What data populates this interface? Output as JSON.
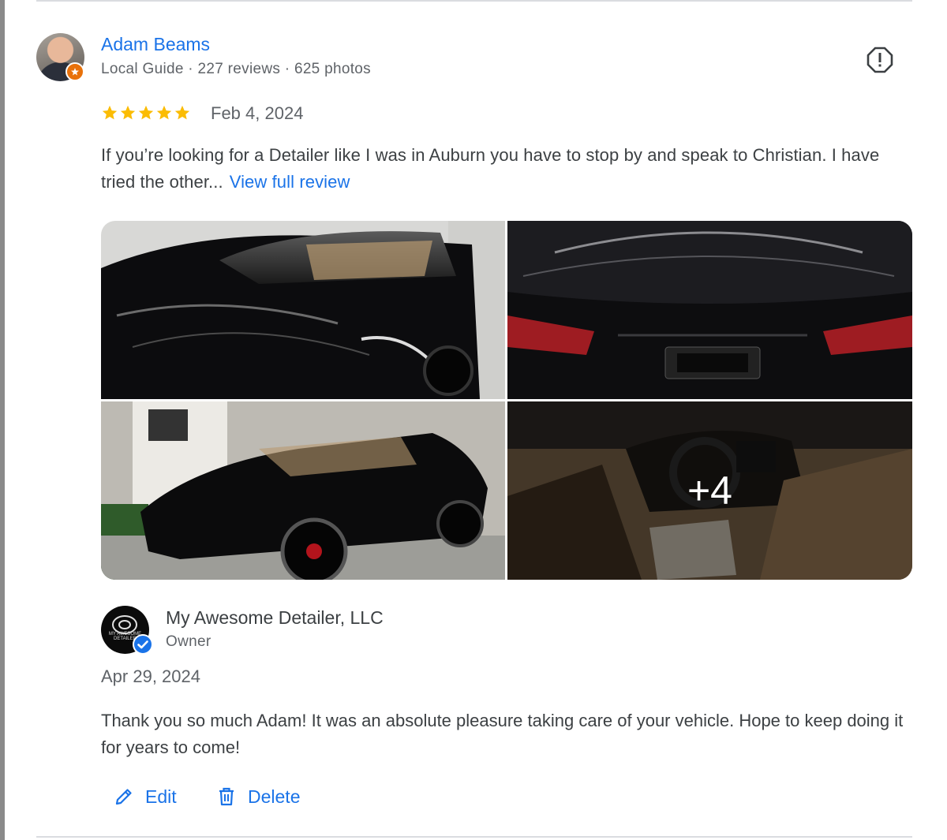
{
  "review": {
    "reviewer_name": "Adam Beams",
    "reviewer_meta": "Local Guide · 227 reviews · 625 photos",
    "rating": 5,
    "max_rating": 5,
    "date": "Feb 4, 2024",
    "text": "If you’re looking for a Detailer like I was in Auburn you have to stop by and speak to Christian. I have tried the other...",
    "view_full_label": "View full review",
    "more_photos_label": "+4"
  },
  "reply": {
    "business_name": "My Awesome Detailer, LLC",
    "role": "Owner",
    "logo_text": "MY AWESOME DETAILER",
    "date": "Apr 29, 2024",
    "text": "Thank you so much Adam! It was an absolute pleasure taking care of your vehicle. Hope to keep doing it for years to come!"
  },
  "actions": {
    "edit_label": "Edit",
    "delete_label": "Delete"
  },
  "icons": {
    "report": "report-icon",
    "star": "star-icon",
    "edit": "pencil-icon",
    "delete": "trash-icon",
    "verified": "verified-check-icon",
    "local_guide": "local-guide-badge-icon"
  },
  "colors": {
    "link": "#1a73e8",
    "star": "#fbbc04",
    "guide_badge": "#e8710a",
    "text": "#3c4043",
    "muted": "#5f6368"
  }
}
